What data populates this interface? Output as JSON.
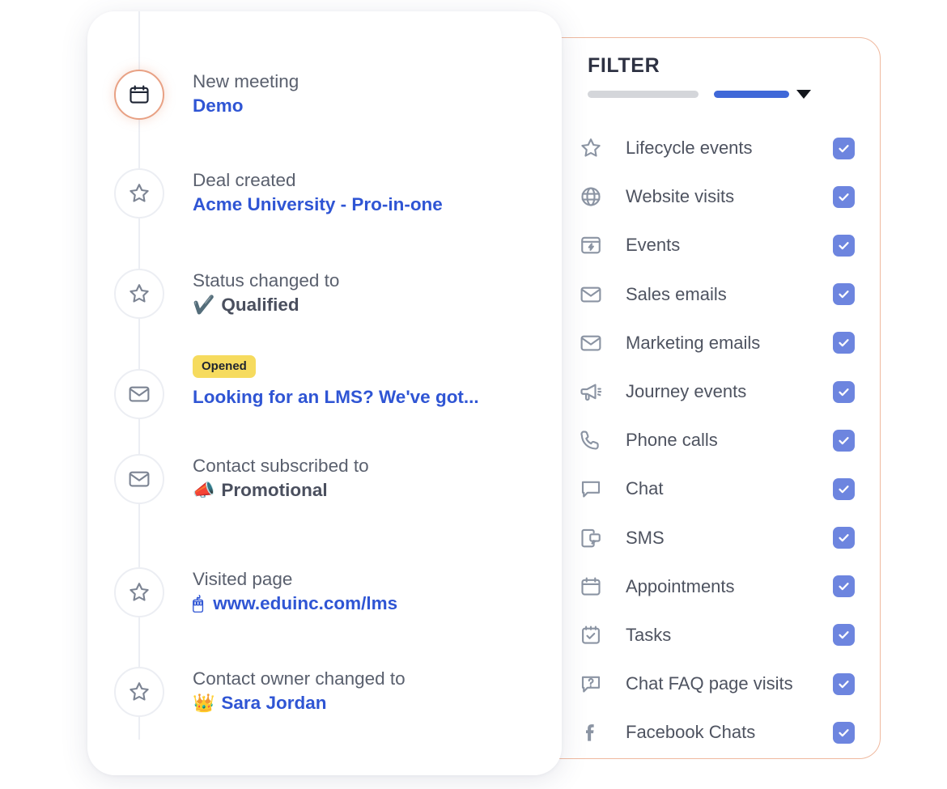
{
  "filter_panel": {
    "title": "FILTER",
    "accent_border": "#efb99f",
    "bar_gray": "#d4d6da",
    "bar_blue": "#3f68d8",
    "checkbox_color": "#6d85df",
    "items": [
      {
        "label": "Lifecycle events",
        "icon": "star-icon",
        "checked": true
      },
      {
        "label": "Website visits",
        "icon": "globe-icon",
        "checked": true
      },
      {
        "label": "Events",
        "icon": "bolt-window-icon",
        "checked": true
      },
      {
        "label": "Sales emails",
        "icon": "envelope-icon",
        "checked": true
      },
      {
        "label": "Marketing emails",
        "icon": "envelope-icon",
        "checked": true
      },
      {
        "label": "Journey events",
        "icon": "megaphone-icon",
        "checked": true
      },
      {
        "label": "Phone calls",
        "icon": "phone-icon",
        "checked": true
      },
      {
        "label": "Chat",
        "icon": "chat-bubble-icon",
        "checked": true
      },
      {
        "label": "SMS",
        "icon": "sms-phone-icon",
        "checked": true
      },
      {
        "label": "Appointments",
        "icon": "calendar-icon",
        "checked": true
      },
      {
        "label": "Tasks",
        "icon": "task-check-icon",
        "checked": true
      },
      {
        "label": "Chat FAQ page visits",
        "icon": "faq-bubble-icon",
        "checked": true
      },
      {
        "label": "Facebook Chats",
        "icon": "facebook-icon",
        "checked": true
      }
    ]
  },
  "timeline": {
    "accent_active": "#e8a184",
    "link_color": "#2f55d4",
    "events": [
      {
        "label": "New meeting",
        "value": "Demo",
        "icon": "calendar-icon",
        "active": true,
        "value_style": "link",
        "badge": null,
        "emoji": null
      },
      {
        "label": "Deal created",
        "value": "Acme University - Pro-in-one",
        "icon": "star-icon",
        "active": false,
        "value_style": "link",
        "badge": null,
        "emoji": null
      },
      {
        "label": "Status changed to",
        "value": "Qualified",
        "icon": "star-icon",
        "active": false,
        "value_style": "dark",
        "badge": null,
        "emoji": "✔️"
      },
      {
        "label": null,
        "value": "Looking for an LMS? We've got...",
        "icon": "envelope-icon",
        "active": false,
        "value_style": "link",
        "badge": "Opened",
        "emoji": null
      },
      {
        "label": "Contact subscribed to",
        "value": "Promotional",
        "icon": "envelope-icon",
        "active": false,
        "value_style": "dark",
        "badge": null,
        "emoji": "📣"
      },
      {
        "label": "Visited page",
        "value": "www.eduinc.com/lms",
        "icon": "star-icon",
        "active": false,
        "value_style": "link",
        "badge": null,
        "emoji": "🖱"
      },
      {
        "label": "Contact owner changed to",
        "value": "Sara Jordan",
        "icon": "star-icon",
        "active": false,
        "value_style": "link",
        "badge": null,
        "emoji": "👑"
      }
    ]
  }
}
